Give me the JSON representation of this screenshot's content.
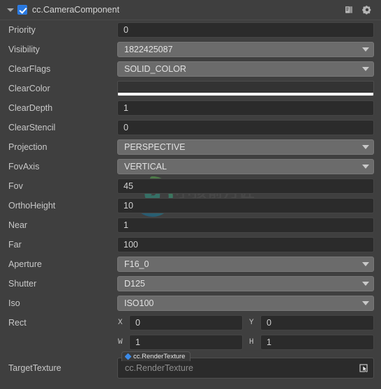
{
  "header": {
    "title": "cc.CameraComponent",
    "enabled": true,
    "fold_icon": "triangle-down-icon",
    "checkbox_icon": "checkbox-checked-icon",
    "help_icon": "book-icon",
    "settings_icon": "gear-icon",
    "accent_color": "#2878e0"
  },
  "watermark": {
    "logo_icon": "bull-in-circle-logo",
    "text": "小孩前月匠",
    "subtext": "www.xiaohaiqianyue.com",
    "ring_color_top": "#4a9a4a",
    "ring_color_bottom": "#1a7b96"
  },
  "properties": [
    {
      "label": "Priority",
      "type": "number",
      "value": "0"
    },
    {
      "label": "Visibility",
      "type": "select",
      "value": "1822425087"
    },
    {
      "label": "ClearFlags",
      "type": "select",
      "value": "SOLID_COLOR"
    },
    {
      "label": "ClearColor",
      "type": "color",
      "value": "#333333",
      "alpha_color": "#ffffff"
    },
    {
      "label": "ClearDepth",
      "type": "number",
      "value": "1"
    },
    {
      "label": "ClearStencil",
      "type": "number",
      "value": "0"
    },
    {
      "label": "Projection",
      "type": "select",
      "value": "PERSPECTIVE"
    },
    {
      "label": "FovAxis",
      "type": "select",
      "value": "VERTICAL"
    },
    {
      "label": "Fov",
      "type": "number",
      "value": "45"
    },
    {
      "label": "OrthoHeight",
      "type": "number",
      "value": "10"
    },
    {
      "label": "Near",
      "type": "number",
      "value": "1"
    },
    {
      "label": "Far",
      "type": "number",
      "value": "100"
    },
    {
      "label": "Aperture",
      "type": "select",
      "value": "F16_0"
    },
    {
      "label": "Shutter",
      "type": "select",
      "value": "D125"
    },
    {
      "label": "Iso",
      "type": "select",
      "value": "ISO100"
    }
  ],
  "rect": {
    "label": "Rect",
    "rows": [
      [
        {
          "key": "X",
          "value": "0"
        },
        {
          "key": "Y",
          "value": "0"
        }
      ],
      [
        {
          "key": "W",
          "value": "1"
        },
        {
          "key": "H",
          "value": "1"
        }
      ]
    ]
  },
  "target_texture": {
    "label": "TargetTexture",
    "badge": "cc.RenderTexture",
    "value": "cc.RenderTexture",
    "badge_icon": "asset-diamond-icon",
    "picker_icon": "cursor-pick-icon"
  },
  "colors": {
    "panel_bg": "#3f3f3f",
    "input_bg": "#2b2b2b",
    "select_bg": "#6b6b6b",
    "label_text": "#c8c8c8"
  }
}
